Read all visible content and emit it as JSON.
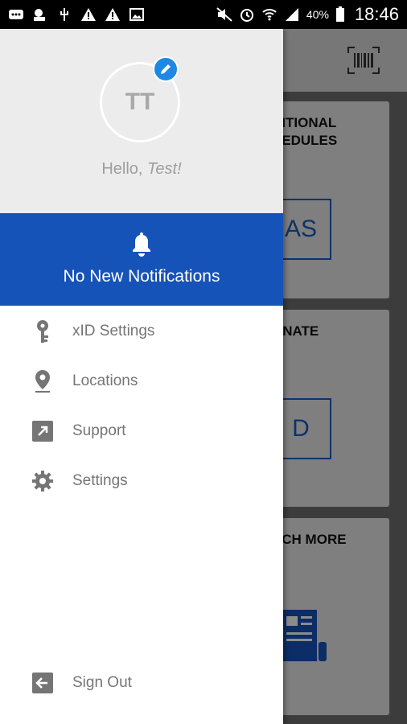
{
  "statusbar": {
    "battery": "40%",
    "time": "18:46"
  },
  "background": {
    "cards": [
      {
        "title": "DITIONAL\nHEDULES",
        "box_text": "AS"
      },
      {
        "title": "ONATE",
        "box_text": "D"
      },
      {
        "title": "UCH MORE",
        "box_text": ""
      }
    ]
  },
  "profile": {
    "initials": "TT",
    "greeting": "Hello, ",
    "name": "Test!"
  },
  "notifications": {
    "text": "No New Notifications"
  },
  "menu": {
    "items": [
      {
        "label": "xID Settings",
        "icon": "key-icon"
      },
      {
        "label": "Locations",
        "icon": "location-pin-icon"
      },
      {
        "label": "Support",
        "icon": "external-link-icon"
      },
      {
        "label": "Settings",
        "icon": "gear-icon"
      }
    ],
    "sign_out": {
      "label": "Sign Out",
      "icon": "sign-out-icon"
    }
  },
  "colors": {
    "accent": "#1653b8",
    "edit_badge": "#1e88e5"
  }
}
